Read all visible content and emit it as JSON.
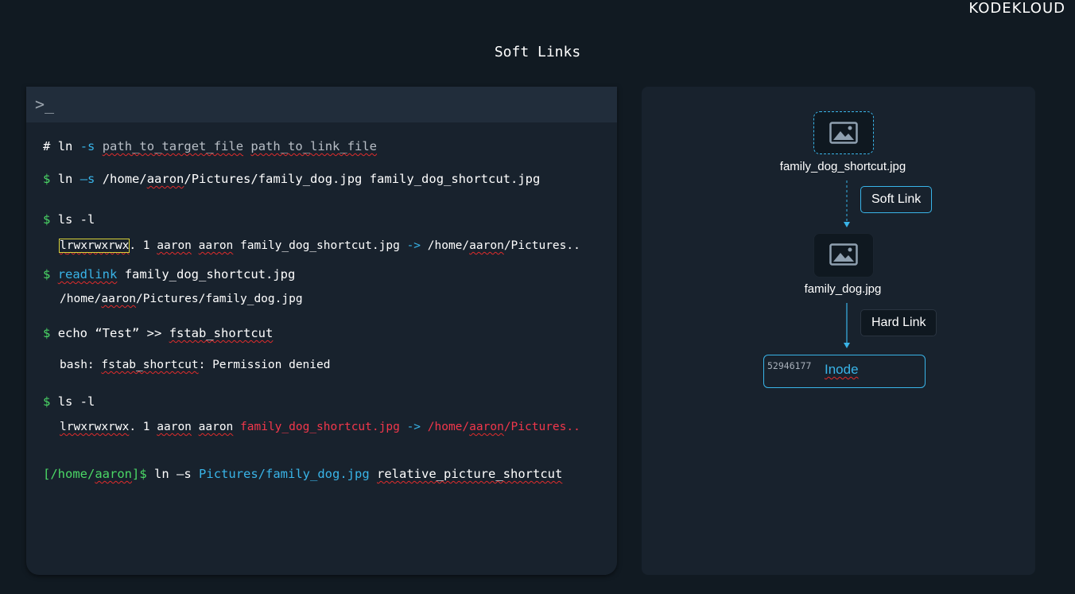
{
  "brand": {
    "logo_text": "KODEKLOUD"
  },
  "page": {
    "title": "Soft Links"
  },
  "terminal": {
    "prompt_icon": ">_",
    "line1": {
      "hash": "#",
      "cmd": "ln",
      "flag": "-s",
      "arg1": "path_to_target_file",
      "arg2": "path_to_link_file"
    },
    "line2": {
      "dollar": "$",
      "cmd": "ln",
      "flag": "–s",
      "arg_pre": "/home/",
      "arg_user": "aaron",
      "arg_post": "/Pictures/family_dog.jpg",
      "arg2": "family_dog_shortcut.jpg"
    },
    "line3": {
      "dollar": "$",
      "cmd": "ls -l"
    },
    "line4": {
      "perms_a": "l",
      "perms_b": "rwxrwxrwx",
      "perms_c": ".",
      "links": "1",
      "owner": "aaron",
      "group": "aaron",
      "name": "family_dog_shortcut.jpg",
      "arrow": "->",
      "target_pre": "/home/",
      "target_user": "aaron",
      "target_post": "/Pictures.."
    },
    "line5": {
      "dollar": "$",
      "cmd": "readlink",
      "arg": "family_dog_shortcut.jpg"
    },
    "line6": {
      "pre": "/home/",
      "user": "aaron",
      "post": "/Pictures/family_dog.jpg"
    },
    "line7": {
      "dollar": "$",
      "cmd": "echo “Test” >>",
      "arg": "fstab_shortcut"
    },
    "line8": {
      "pre": "bash:",
      "file": "fstab_shortcut",
      "post": ": Permission denied"
    },
    "line9": {
      "dollar": "$",
      "cmd": "ls -l"
    },
    "line10": {
      "perms": "lrwxrwxrwx",
      "dot": ".",
      "links": "1",
      "owner": "aaron",
      "group": "aaron",
      "name": "family_dog_shortcut.jpg",
      "arrow": "->",
      "target_pre": "/home/",
      "target_user": "aaron",
      "target_post": "/Pictures.."
    },
    "line11": {
      "prompt_pre": "[/home/",
      "prompt_user": "aaron",
      "prompt_post": "]$",
      "cmd": "ln –s",
      "arg1": "Pictures/family_dog.jpg",
      "arg2": "relative_picture_shortcut"
    }
  },
  "diagram": {
    "shortcut_file": "family_dog_shortcut.jpg",
    "soft_link_label": "Soft Link",
    "target_file": "family_dog.jpg",
    "hard_link_label": "Hard Link",
    "inode_number": "52946177",
    "inode_label": "Inode"
  },
  "colors": {
    "accent": "#39b4e8",
    "prompt_green": "#4bd866",
    "error_red": "#f2374b",
    "background": "#111a22",
    "panel": "#18222d"
  }
}
